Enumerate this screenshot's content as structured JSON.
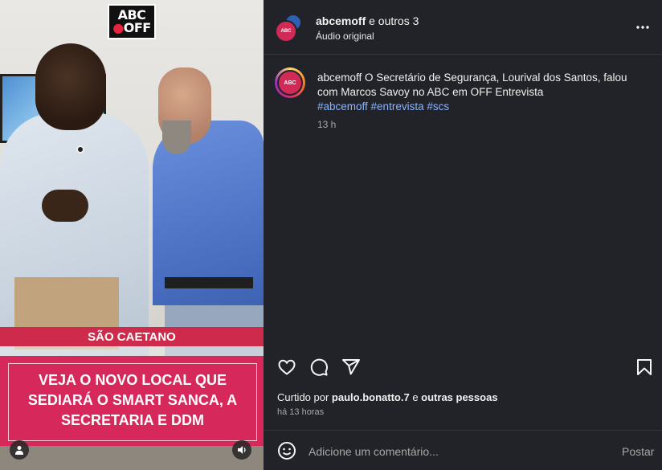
{
  "media": {
    "logo_line1": "ABC",
    "logo_line2a": "",
    "logo_line2b": "OFF",
    "location_tag": "SÃO CAETANO",
    "headline": [
      "VEJA O NOVO LOCAL QUE",
      "SEDIARÁ O SMART SANCA, A",
      "SECRETARIA E DDM"
    ]
  },
  "header": {
    "username": "abcemoff",
    "others": "e outros 3",
    "subtitle": "Áudio original"
  },
  "caption": {
    "username": "abcemoff",
    "text": " O Secretário de Segurança, Lourival dos Santos, falou com Marcos Savoy no ABC em OFF Entrevista",
    "hashtags": "#abcemoff #entrevista #scs",
    "time": "13 h"
  },
  "likes": {
    "prefix": "Curtido por ",
    "user": "paulo.bonatto.7",
    "middle": " e ",
    "others": "outras pessoas"
  },
  "posted_ago": "há 13 horas",
  "comment": {
    "placeholder": "Adicione um comentário...",
    "post_label": "Postar"
  },
  "colors": {
    "panel_bg": "#212328",
    "accent_pink": "#d6285a",
    "ribbon_red": "#ce2a4b",
    "hashtag_blue": "#8ab4ff"
  },
  "icons": [
    "heart-icon",
    "comment-icon",
    "share-icon",
    "bookmark-icon",
    "more-icon",
    "emoji-icon",
    "user-tag-icon",
    "audio-icon"
  ]
}
